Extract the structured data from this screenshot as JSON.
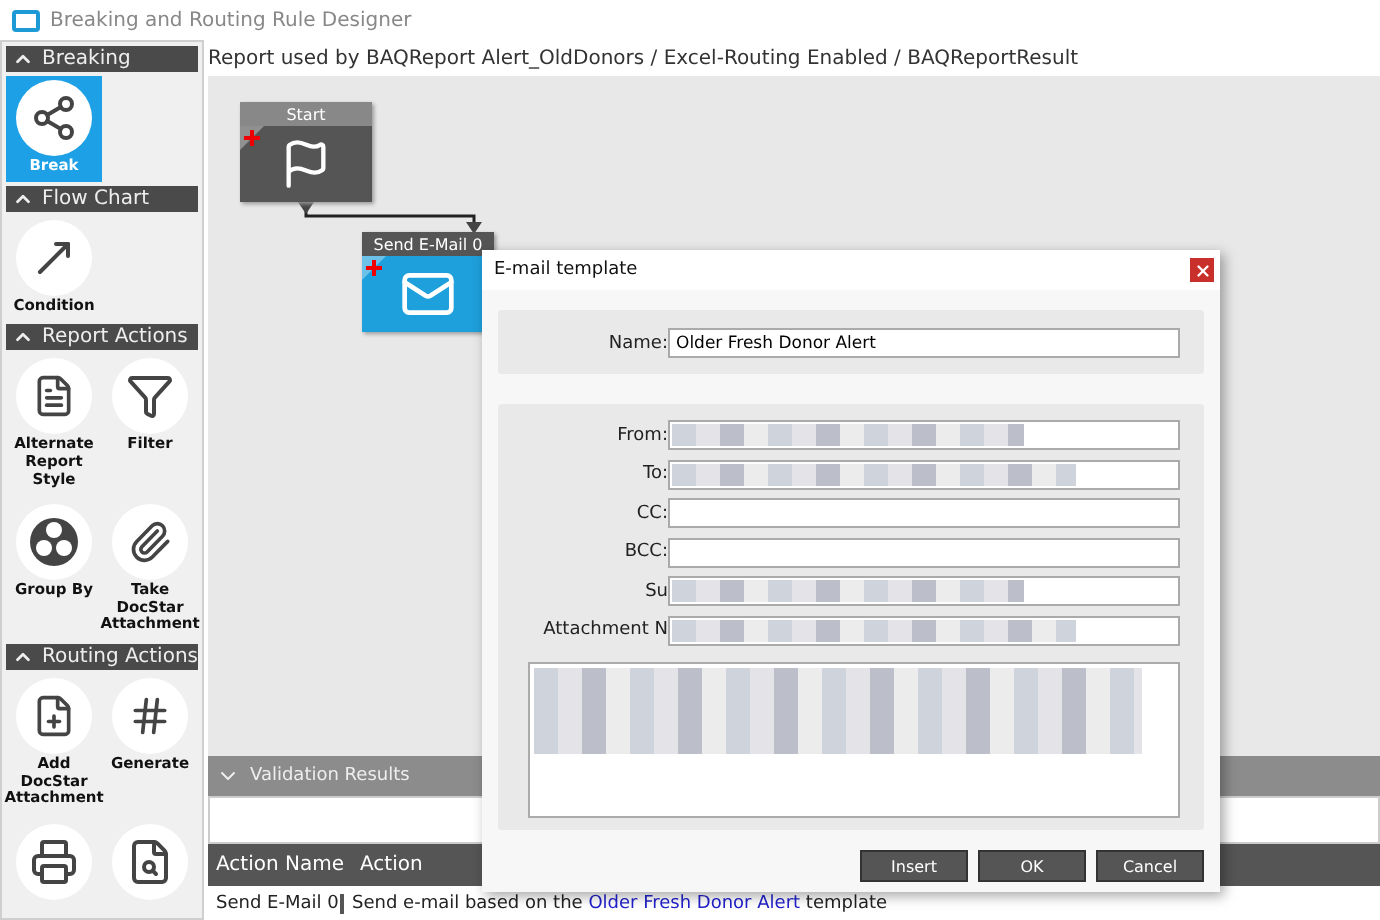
{
  "window": {
    "title": "Breaking and Routing Rule Designer"
  },
  "sidebar": {
    "sections": [
      {
        "title": "Breaking",
        "expanded": true,
        "items": [
          {
            "label": "Break",
            "kind": "break",
            "selected": true
          }
        ]
      },
      {
        "title": "Flow Chart",
        "expanded": true,
        "items": [
          {
            "label": "Condition",
            "kind": "condition",
            "selected": false
          }
        ]
      },
      {
        "title": "Report Actions",
        "expanded": true,
        "items": [
          {
            "label": "Alternate Report Style",
            "kind": "report",
            "selected": false
          },
          {
            "label": "Filter",
            "kind": "filter",
            "selected": false
          },
          {
            "label": "Group By",
            "kind": "group",
            "selected": false
          },
          {
            "label": "Take DocStar Attachment",
            "kind": "take",
            "selected": false
          }
        ]
      },
      {
        "title": "Routing Actions",
        "expanded": true,
        "items": [
          {
            "label": "Add DocStar Attachment",
            "kind": "add",
            "selected": false
          },
          {
            "label": "Generate",
            "kind": "generate",
            "selected": false
          },
          {
            "kind": "print",
            "selected": false
          },
          {
            "kind": "search",
            "selected": false
          }
        ]
      }
    ]
  },
  "breadcrumb": "Report used by BAQReport Alert_OldDonors / Excel-Routing Enabled / BAQReportResult",
  "canvas": {
    "nodes": [
      {
        "title": "Start",
        "kind": "start"
      },
      {
        "title": "Send E-Mail 0",
        "kind": "email"
      }
    ]
  },
  "validation": {
    "title": "Validation Results",
    "expanded": false
  },
  "actions_table": {
    "columns": [
      "Action Name",
      "Action"
    ],
    "rows": [
      {
        "name": "Send E-Mail 0",
        "action_prefix": "Send e-mail based on the",
        "action_link": "Older Fresh Donor Alert",
        "action_suffix": "template"
      }
    ]
  },
  "dialog": {
    "title": "E-mail template",
    "name_label": "Name:",
    "name_value": "Older Fresh Donor Alert",
    "fields": [
      {
        "label": "From:",
        "redacted": true
      },
      {
        "label": "To:",
        "redacted": true
      },
      {
        "label": "CC:",
        "redacted": false
      },
      {
        "label": "BCC:",
        "redacted": false
      },
      {
        "label": "Su",
        "redacted": true
      },
      {
        "label": "Attachment N",
        "redacted": true
      }
    ],
    "body_redacted": true,
    "buttons": [
      "Insert",
      "OK",
      "Cancel"
    ]
  }
}
